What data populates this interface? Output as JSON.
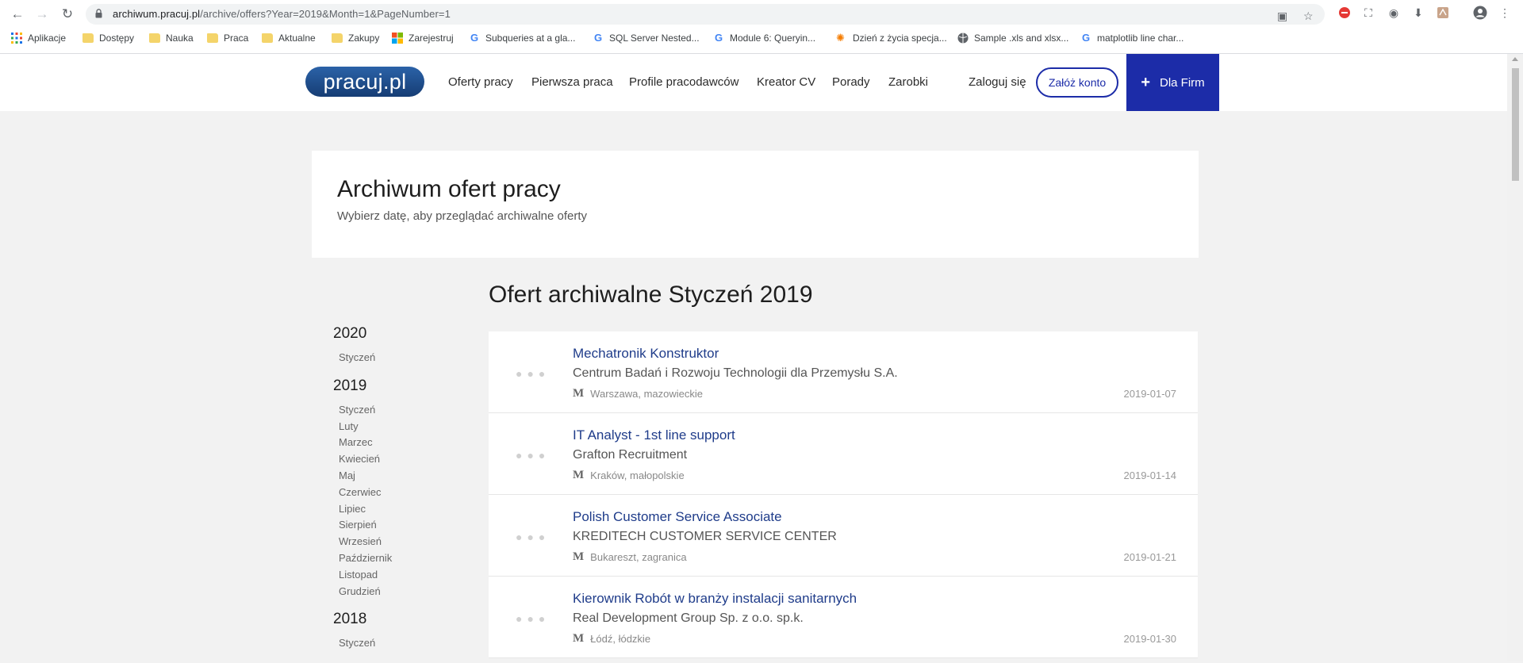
{
  "browser": {
    "url_host": "archiwum.pracuj.pl",
    "url_path": "/archive/offers?Year=2019&Month=1&PageNumber=1",
    "bookmarks": [
      {
        "label": "Aplikacje",
        "icon": "apps-grid-icon"
      },
      {
        "label": "Dostępy",
        "icon": "folder-icon"
      },
      {
        "label": "Nauka",
        "icon": "folder-icon"
      },
      {
        "label": "Praca",
        "icon": "folder-icon"
      },
      {
        "label": "Aktualne",
        "icon": "folder-icon"
      },
      {
        "label": "Zakupy",
        "icon": "folder-icon"
      },
      {
        "label": "Zarejestruj",
        "icon": "windows-logo-icon"
      },
      {
        "label": "Subqueries at a gla...",
        "icon": "google-icon"
      },
      {
        "label": "SQL Server Nested...",
        "icon": "google-icon"
      },
      {
        "label": "Module 6: Queryin...",
        "icon": "google-icon"
      },
      {
        "label": "Dzień z życia specja...",
        "icon": "star-burst-icon"
      },
      {
        "label": "Sample .xls and xlsx...",
        "icon": "globe-icon"
      },
      {
        "label": "matplotlib line char...",
        "icon": "google-icon"
      }
    ]
  },
  "header": {
    "logo": "pracuj.pl",
    "nav": [
      "Oferty pracy",
      "Pierwsza praca",
      "Profile pracodawców",
      "Kreator CV",
      "Porady",
      "Zarobki"
    ],
    "login": "Zaloguj się",
    "register": "Załóż konto",
    "firms": "Dla Firm"
  },
  "hero": {
    "title": "Archiwum ofert pracy",
    "subtitle": "Wybierz datę, aby przeglądać archiwalne oferty"
  },
  "section_title": "Ofert archiwalne Styczeń 2019",
  "archive": [
    {
      "year": "2020",
      "months": [
        "Styczeń"
      ]
    },
    {
      "year": "2019",
      "months": [
        "Styczeń",
        "Luty",
        "Marzec",
        "Kwiecień",
        "Maj",
        "Czerwiec",
        "Lipiec",
        "Sierpień",
        "Wrzesień",
        "Październik",
        "Listopad",
        "Grudzień"
      ]
    },
    {
      "year": "2018",
      "months": [
        "Styczeń"
      ]
    }
  ],
  "offers": [
    {
      "title": "Mechatronik Konstruktor",
      "company": "Centrum Badań i Rozwoju Technologii dla Przemysłu S.A.",
      "location": "Warszawa, mazowieckie",
      "date": "2019-01-07"
    },
    {
      "title": "IT Analyst - 1st line support",
      "company": "Grafton Recruitment",
      "location": "Kraków, małopolskie",
      "date": "2019-01-14"
    },
    {
      "title": "Polish Customer Service Associate",
      "company": "KREDITECH CUSTOMER SERVICE CENTER",
      "location": "Bukareszt, zagranica",
      "date": "2019-01-21"
    },
    {
      "title": "Kierownik Robót w branży instalacji sanitarnych",
      "company": "Real Development Group Sp. z o.o. sp.k.",
      "location": "Łódź, łódzkie",
      "date": "2019-01-30"
    }
  ]
}
